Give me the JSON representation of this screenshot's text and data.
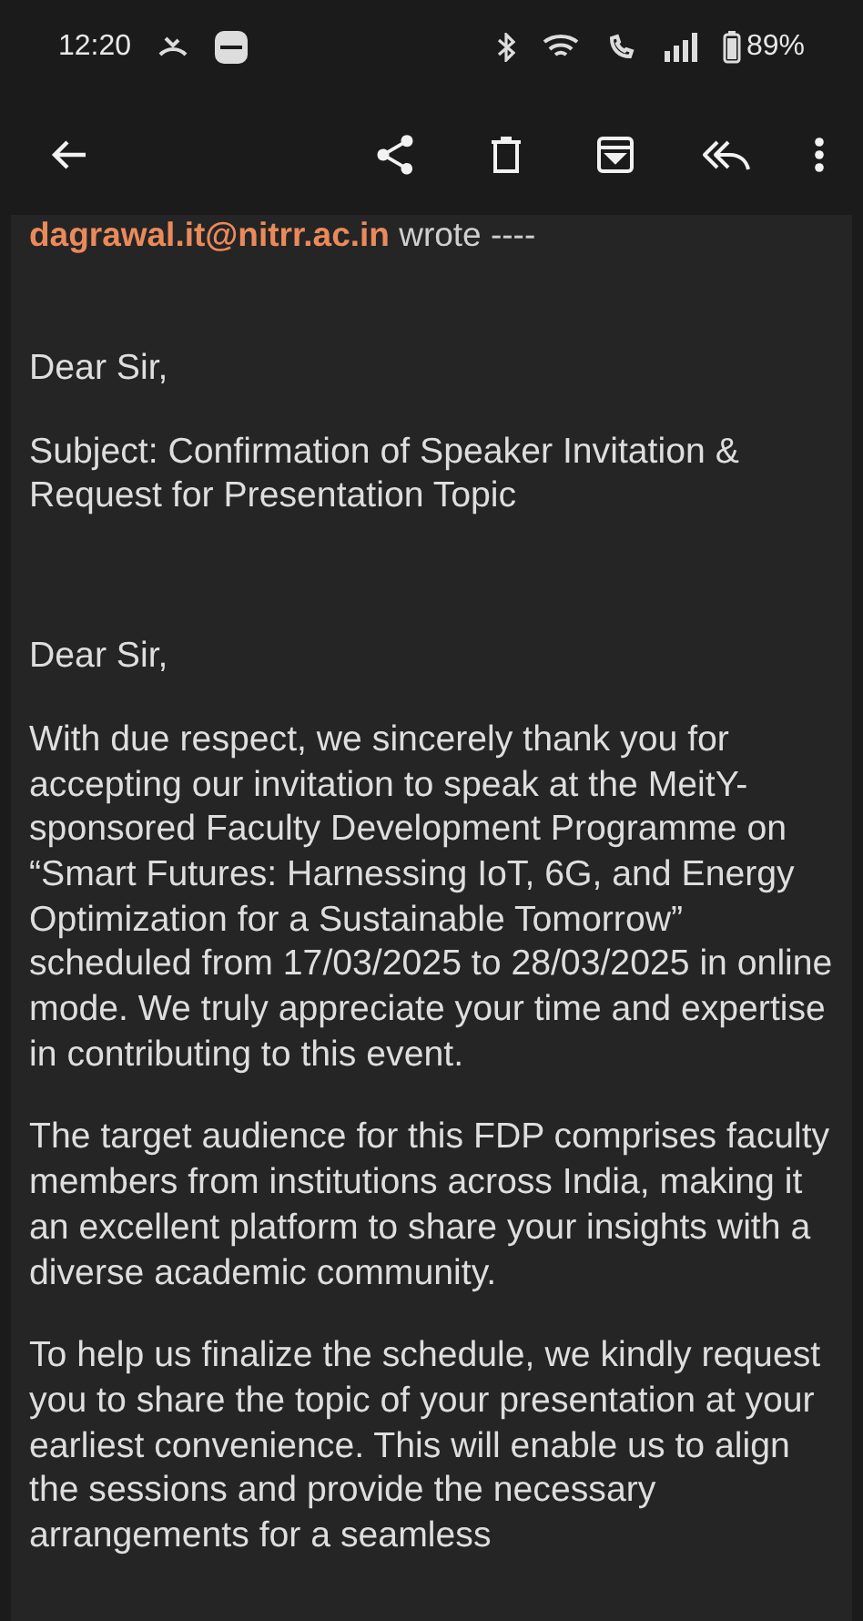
{
  "status_bar": {
    "time": "12:20",
    "battery": "89%"
  },
  "message": {
    "quoted_header": {
      "sender": "dagrawal.it@nitrr.ac.in",
      "suffix": "wrote ----"
    },
    "paragraphs": [
      {
        "kind": "text",
        "text": "Dear Sir,"
      },
      {
        "kind": "text",
        "text": "Subject: Confirmation of Speaker Invitation & Request for Presentation Topic"
      },
      {
        "kind": "gap"
      },
      {
        "kind": "text",
        "text": "Dear Sir,"
      },
      {
        "kind": "text",
        "text": "With due respect, we sincerely thank you for accepting our invitation to speak at the MeitY-sponsored Faculty Development Programme on “Smart Futures: Harnessing IoT, 6G, and Energy Optimization for a Sustainable Tomorrow” scheduled from 17/03/2025 to 28/03/2025 in online mode. We truly appreciate your time and expertise in contributing to this event."
      },
      {
        "kind": "text",
        "text": "The target audience for this FDP comprises faculty members from institutions across India, making it an excellent platform to share your insights with a diverse academic community."
      },
      {
        "kind": "text",
        "text": "To help us finalize the schedule, we kindly request you to share the topic of your presentation at your earliest convenience. This will enable us to align the sessions and provide the necessary arrangements for a seamless"
      }
    ]
  }
}
